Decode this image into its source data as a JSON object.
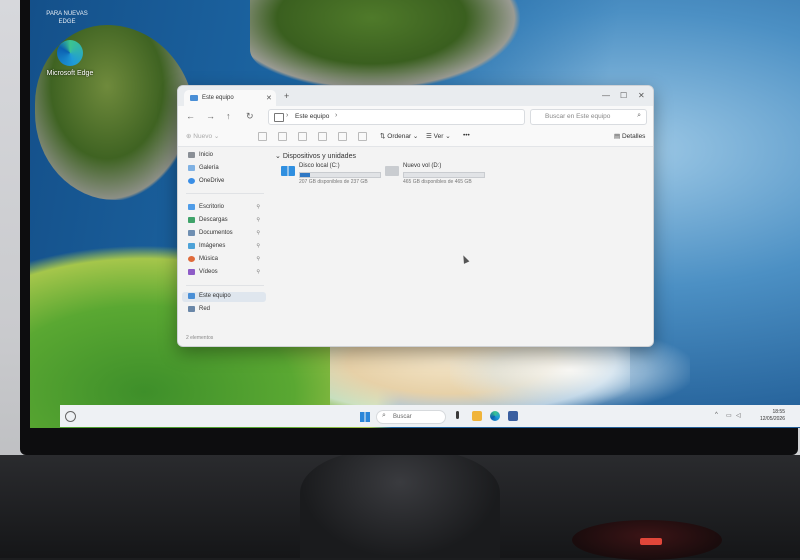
{
  "desktop": {
    "top_label_line1": "PARA NUEVAS",
    "top_label_line2": "EDGE",
    "icons": [
      {
        "label": "Microsoft Edge",
        "icon": "edge-icon"
      }
    ]
  },
  "explorer": {
    "tab_title": "Este equipo",
    "tab_close": "✕",
    "new_tab": "+",
    "window_buttons": {
      "minimize": "—",
      "maximize": "☐",
      "close": "✕"
    },
    "nav": {
      "back": "←",
      "forward": "→",
      "up": "↑",
      "refresh": "↻"
    },
    "address": {
      "location": "Este equipo"
    },
    "search": {
      "placeholder": "Buscar en Este equipo",
      "icon": "search-icon"
    },
    "commands": {
      "new": "Nuevo",
      "sort": "Ordenar",
      "view": "Ver",
      "more": "•••",
      "details": "Detalles"
    },
    "sidebar": {
      "items": [
        {
          "label": "Inicio",
          "icon": "home-icon",
          "color": "#8a8f96",
          "pinned": false
        },
        {
          "label": "Galería",
          "icon": "gallery-icon",
          "color": "#7fb1e3",
          "pinned": false
        },
        {
          "label": "OneDrive",
          "icon": "cloud-icon",
          "color": "#3a8ee6",
          "pinned": false
        },
        {
          "label": "Escritorio",
          "icon": "desktop-icon",
          "color": "#4f9ce8",
          "pinned": true
        },
        {
          "label": "Descargas",
          "icon": "download-icon",
          "color": "#3fa36a",
          "pinned": true
        },
        {
          "label": "Documentos",
          "icon": "documents-icon",
          "color": "#6f8fb2",
          "pinned": true
        },
        {
          "label": "Imágenes",
          "icon": "pictures-icon",
          "color": "#4ea3d8",
          "pinned": true
        },
        {
          "label": "Música",
          "icon": "music-icon",
          "color": "#e06b3b",
          "pinned": true
        },
        {
          "label": "Vídeos",
          "icon": "videos-icon",
          "color": "#8e5cc7",
          "pinned": true
        },
        {
          "label": "Este equipo",
          "icon": "pc-icon",
          "color": "#4a8fd6",
          "pinned": false,
          "selected": true
        },
        {
          "label": "Red",
          "icon": "network-icon",
          "color": "#6a87a8",
          "pinned": false
        }
      ],
      "pin_glyph": "📌"
    },
    "section_title": "Dispositivos y unidades",
    "drives": [
      {
        "name": "Disco local (C:)",
        "capacity": "207 GB disponibles de 237 GB",
        "used_fraction": 0.13,
        "icon": "windows-drive-icon"
      },
      {
        "name": "Nuevo vol (D:)",
        "capacity": "465 GB disponibles de 465 GB",
        "used_fraction": 0.0,
        "icon": "drive-icon"
      }
    ],
    "status": "2 elementos"
  },
  "taskbar": {
    "search_label": "Buscar",
    "clock_time": "18:55",
    "clock_date": "12/05/2026"
  }
}
